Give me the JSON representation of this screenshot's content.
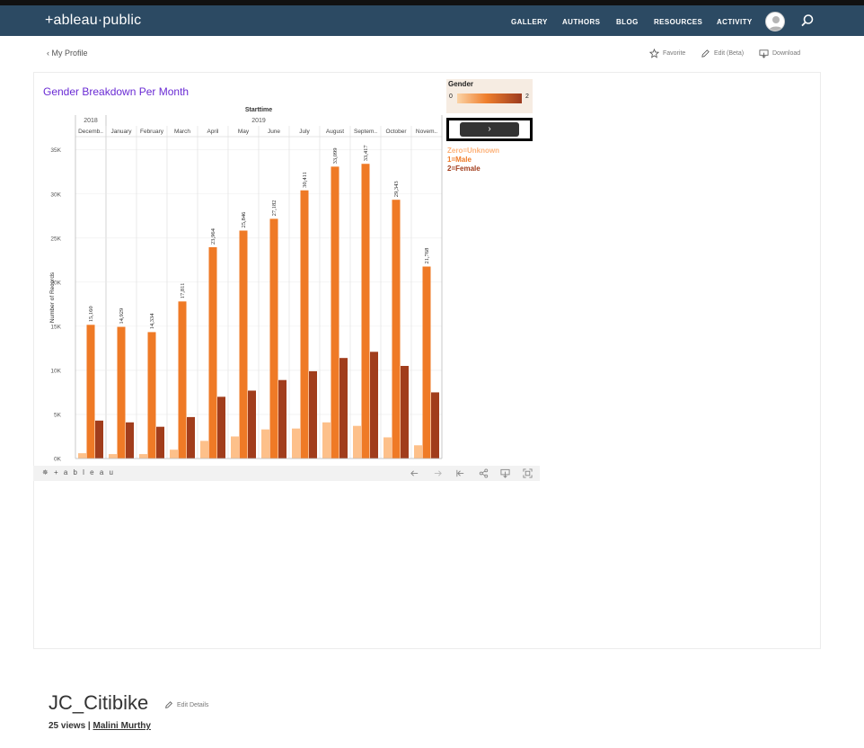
{
  "nav": {
    "logo": "+ableau·public",
    "links": [
      "GALLERY",
      "AUTHORS",
      "BLOG",
      "RESOURCES",
      "ACTIVITY"
    ]
  },
  "subbar": {
    "back_label": "My Profile",
    "favorite_label": "Favorite",
    "edit_label": "Edit (Beta)",
    "download_label": "Download"
  },
  "viz": {
    "title": "Gender Breakdown Per Month",
    "legend": {
      "title": "Gender",
      "min": "0",
      "max": "2",
      "notes": [
        "Zero=Unknown",
        "1=Male",
        "2=Female"
      ]
    },
    "next_label": "›",
    "toolbar_brand": "+ a b l e a u"
  },
  "colors": {
    "nav_bg": "#2c4a63",
    "unknown": "#fdc08a",
    "male": "#ef7a26",
    "female": "#a13d1c",
    "title": "#6a2bd4"
  },
  "chart_data": {
    "type": "bar",
    "title": "",
    "column_header": "Starttime",
    "years": [
      {
        "label": "2018",
        "span": 1
      },
      {
        "label": "2019",
        "span": 11
      }
    ],
    "categories": [
      "Decemb..",
      "January",
      "February",
      "March",
      "April",
      "May",
      "June",
      "July",
      "August",
      "Septem..",
      "October",
      "Novem.."
    ],
    "ylabel": "Number of Records",
    "ylim": [
      0,
      36500
    ],
    "yticks": [
      0,
      5000,
      10000,
      15000,
      20000,
      25000,
      30000,
      35000
    ],
    "ytick_labels": [
      "0K",
      "5K",
      "10K",
      "15K",
      "20K",
      "25K",
      "30K",
      "35K"
    ],
    "series": [
      {
        "values": [
          600,
          500,
          500,
          1000,
          2000,
          2500,
          3300,
          3400,
          4100,
          3700,
          2400,
          1500
        ]
      },
      {
        "values": [
          15160,
          14929,
          14334,
          17811,
          23964,
          25846,
          27182,
          30411,
          33099,
          33417,
          29343,
          21768
        ]
      },
      {
        "values": [
          4300,
          4100,
          3600,
          4700,
          7000,
          7700,
          8900,
          9900,
          11400,
          12100,
          10500,
          7500
        ]
      }
    ],
    "data_labels": [
      "15,160",
      "14,929",
      "14,334",
      "17,811",
      "23,964",
      "25,846",
      "27,182",
      "30,411",
      "33,099",
      "33,417",
      "29,343",
      "21,768"
    ],
    "grid": true,
    "legend": "right"
  },
  "workbook": {
    "title": "JC_Citibike",
    "edit_details": "Edit Details",
    "views": "25 views |",
    "author": "Malini Murthy"
  }
}
